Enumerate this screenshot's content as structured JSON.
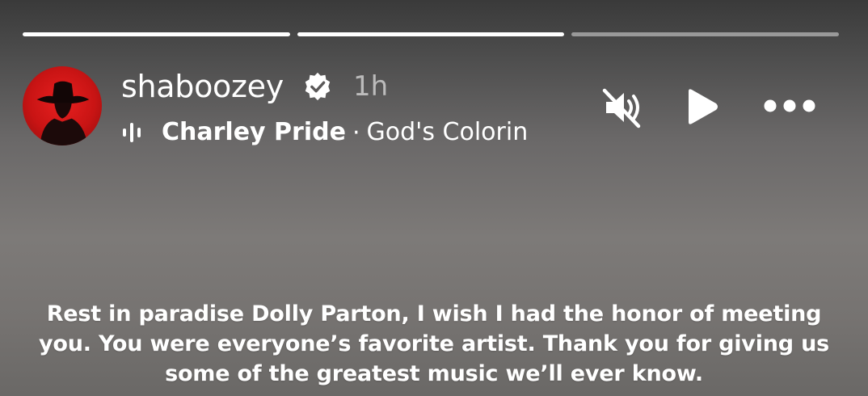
{
  "story": {
    "progress": [
      1.0,
      1.0,
      0.0
    ]
  },
  "header": {
    "username": "shaboozey",
    "verified_icon": "verified-badge-icon",
    "time": "1h",
    "music": {
      "icon": "audio-bars-icon",
      "artist": "Charley Pride",
      "separator": "·",
      "song": "God's Colorin"
    }
  },
  "controls": {
    "mute_icon": "speaker-muted-icon",
    "play_icon": "play-icon",
    "more_icon": "more-options-icon"
  },
  "caption": {
    "lines": [
      "Rest in paradise Dolly Parton, I wish I had the honor of meeting",
      "you. You were everyone’s favorite artist. Thank you for giving us",
      "some of the greatest music we’ll ever know."
    ]
  },
  "colors": {
    "avatar_bg": "#d41a1a",
    "text": "#ffffff"
  }
}
